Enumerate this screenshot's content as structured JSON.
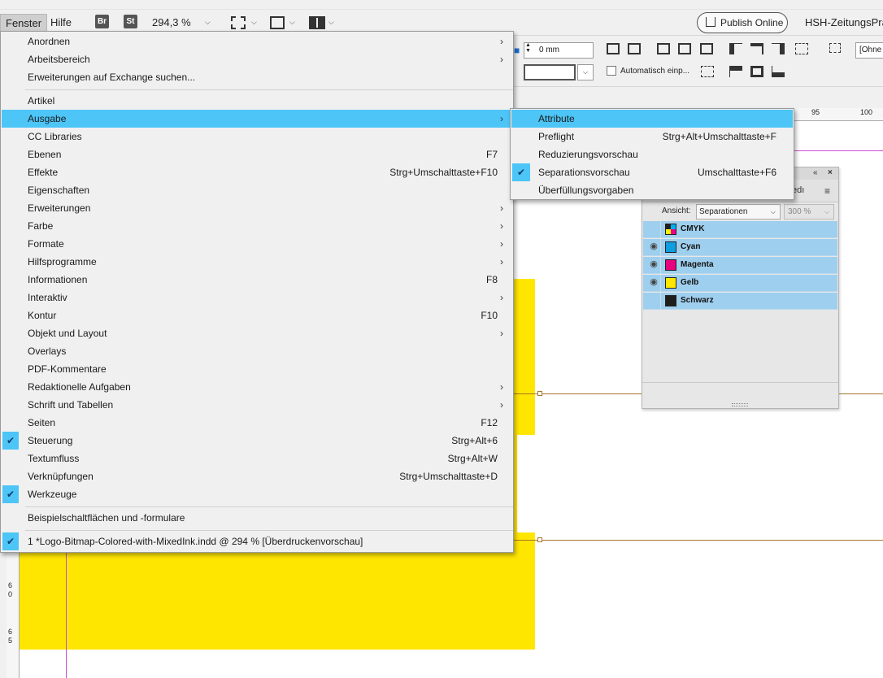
{
  "menubar": {
    "fenster": "Fenster",
    "hilfe": "Hilfe",
    "br": "Br",
    "st": "St",
    "zoom": "294,3 %",
    "publish": "Publish Online",
    "workspace": "HSH-ZeitungsPrak"
  },
  "control": {
    "offset_value": "0 mm",
    "auto_label": "Automatisch einp...",
    "ohne": "[Ohne"
  },
  "ruler": {
    "t95": "95",
    "t100": "100",
    "l6": "6",
    "l0": "0",
    "l65": "6",
    "l5": "5"
  },
  "window_menu": {
    "items": [
      {
        "label": "Anordnen",
        "shortcut": "",
        "submenu": true
      },
      {
        "label": "Arbeitsbereich",
        "shortcut": "",
        "submenu": true
      },
      {
        "label": "Erweiterungen auf Exchange suchen...",
        "shortcut": "",
        "submenu": false
      },
      {
        "label": "Artikel",
        "shortcut": "",
        "submenu": false
      },
      {
        "label": "Ausgabe",
        "shortcut": "",
        "submenu": true,
        "highlighted": true
      },
      {
        "label": "CC Libraries",
        "shortcut": "",
        "submenu": false
      },
      {
        "label": "Ebenen",
        "shortcut": "F7",
        "submenu": false
      },
      {
        "label": "Effekte",
        "shortcut": "Strg+Umschalttaste+F10",
        "submenu": false
      },
      {
        "label": "Eigenschaften",
        "shortcut": "",
        "submenu": false
      },
      {
        "label": "Erweiterungen",
        "shortcut": "",
        "submenu": true
      },
      {
        "label": "Farbe",
        "shortcut": "",
        "submenu": true
      },
      {
        "label": "Formate",
        "shortcut": "",
        "submenu": true
      },
      {
        "label": "Hilfsprogramme",
        "shortcut": "",
        "submenu": true
      },
      {
        "label": "Informationen",
        "shortcut": "F8",
        "submenu": false
      },
      {
        "label": "Interaktiv",
        "shortcut": "",
        "submenu": true
      },
      {
        "label": "Kontur",
        "shortcut": "F10",
        "submenu": false
      },
      {
        "label": "Objekt und Layout",
        "shortcut": "",
        "submenu": true
      },
      {
        "label": "Overlays",
        "shortcut": "",
        "submenu": false
      },
      {
        "label": "PDF-Kommentare",
        "shortcut": "",
        "submenu": false
      },
      {
        "label": "Redaktionelle Aufgaben",
        "shortcut": "",
        "submenu": true
      },
      {
        "label": "Schrift und Tabellen",
        "shortcut": "",
        "submenu": true
      },
      {
        "label": "Seiten",
        "shortcut": "F12",
        "submenu": false
      },
      {
        "label": "Steuerung",
        "shortcut": "Strg+Alt+6",
        "submenu": false,
        "checked": true
      },
      {
        "label": "Textumfluss",
        "shortcut": "Strg+Alt+W",
        "submenu": false
      },
      {
        "label": "Verknüpfungen",
        "shortcut": "Strg+Umschalttaste+D",
        "submenu": false
      },
      {
        "label": "Werkzeuge",
        "shortcut": "",
        "submenu": false,
        "checked": true
      },
      {
        "label": "Beispielschaltflächen und -formulare",
        "shortcut": "",
        "submenu": false
      },
      {
        "label": "1 *Logo-Bitmap-Colored-with-MixedInk.indd @ 294 % [Überdruckenvorschau]",
        "shortcut": "",
        "submenu": false,
        "checked": true
      }
    ]
  },
  "output_submenu": {
    "items": [
      {
        "label": "Attribute",
        "shortcut": "",
        "highlighted": true
      },
      {
        "label": "Preflight",
        "shortcut": "Strg+Alt+Umschalttaste+F"
      },
      {
        "label": "Reduzierungsvorschau",
        "shortcut": ""
      },
      {
        "label": "Separationsvorschau",
        "shortcut": "Umschalttaste+F6",
        "checked": true
      },
      {
        "label": "Überfüllungsvorgaben",
        "shortcut": ""
      }
    ]
  },
  "separations_panel": {
    "tab_fragment": "edı",
    "view_label": "Ansicht:",
    "view_value": "Separationen",
    "zoom_value": "300 %",
    "rows": [
      {
        "name": "CMYK",
        "visible": false,
        "color": "cmyk"
      },
      {
        "name": "Cyan",
        "visible": true,
        "color": "#0d9ee0"
      },
      {
        "name": "Magenta",
        "visible": true,
        "color": "#e6007e"
      },
      {
        "name": "Gelb",
        "visible": true,
        "color": "#ffe600"
      },
      {
        "name": "Schwarz",
        "visible": false,
        "color": "#1d1d1b"
      }
    ]
  },
  "colors": {
    "highlight": "#4dc5f7",
    "page_yellow": "#ffe600",
    "guide_magenta": "#d24bd6",
    "guide_orange": "#a8752a"
  }
}
